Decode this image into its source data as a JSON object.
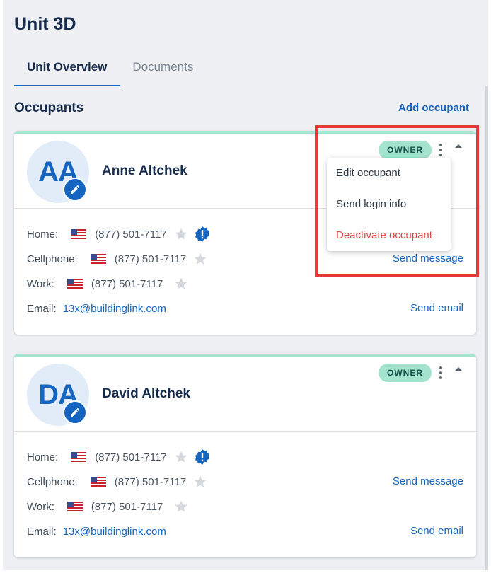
{
  "unit_title": "Unit 3D",
  "tabs": [
    {
      "label": "Unit Overview",
      "active": true
    },
    {
      "label": "Documents",
      "active": false
    }
  ],
  "section_title": "Occupants",
  "add_occupant_label": "Add occupant",
  "colors": {
    "accent": "#1565c0",
    "owner_badge": "#a4e4cf",
    "danger": "#e24444",
    "highlight": "#e53935"
  },
  "occupants": [
    {
      "initials": "AA",
      "name": "Anne Altchek",
      "badge": "OWNER",
      "home_label": "Home:",
      "home_phone": "(877) 501-7117",
      "cell_label": "Cellphone:",
      "cell_phone": "(877) 501-7117",
      "work_label": "Work:",
      "work_phone": "(877) 501-7117",
      "email_label": "Email:",
      "email": "13x@buildinglink.com",
      "send_message": "Send message",
      "send_email": "Send email"
    },
    {
      "initials": "DA",
      "name": "David Altchek",
      "badge": "OWNER",
      "home_label": "Home:",
      "home_phone": "(877) 501-7117",
      "cell_label": "Cellphone:",
      "cell_phone": "(877) 501-7117",
      "work_label": "Work:",
      "work_phone": "(877) 501-7117",
      "email_label": "Email:",
      "email": "13x@buildinglink.com",
      "send_message": "Send message",
      "send_email": "Send email"
    }
  ],
  "context_menu": {
    "items": [
      "Edit occupant",
      "Send login info",
      "Deactivate occupant"
    ]
  },
  "icons": [
    "pencil-icon",
    "us-flag-icon",
    "star-icon",
    "alert-icon",
    "kebab-menu-icon",
    "caret-up-icon"
  ]
}
